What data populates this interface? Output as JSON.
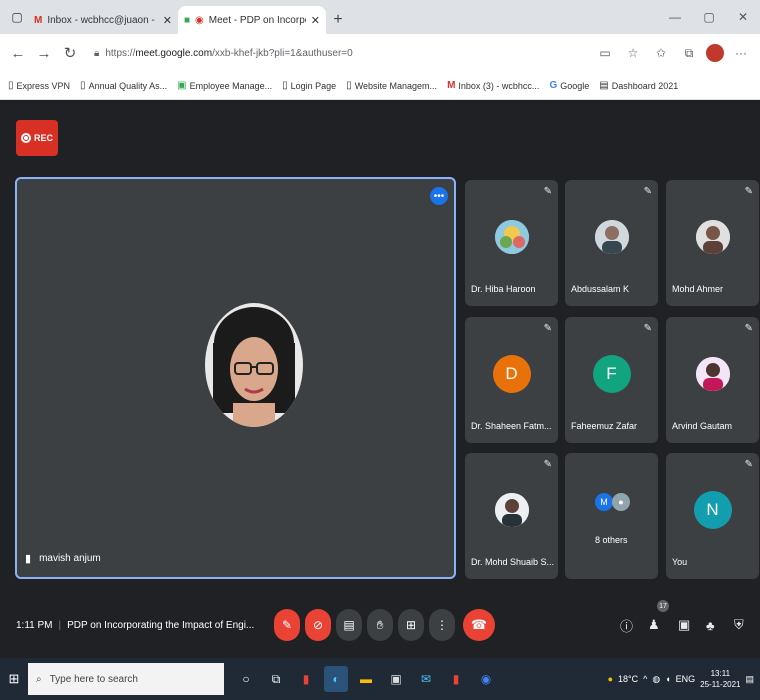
{
  "browser": {
    "tabs": [
      {
        "title": "Inbox - wcbhcc@juaon - E.M",
        "active": false
      },
      {
        "title": "Meet - PDP on Incorporati",
        "active": true
      }
    ],
    "url_prefix": "https://",
    "url_host": "meet.google.com",
    "url_path": "/xxb-khef-jkb?pli=1&authuser=0",
    "bookmarks": [
      "Express VPN",
      "Annual Quality As...",
      "Employee Manage...",
      "Login Page",
      "Website Managem...",
      "Inbox (3) - wcbhcc...",
      "Google",
      "Dashboard 2021"
    ]
  },
  "meet": {
    "rec_label": "REC",
    "main_speaker": "mavish anjum",
    "participants": [
      {
        "name": "Dr. Hiba Haroon",
        "avatar": "photo",
        "color": "#6aa84f"
      },
      {
        "name": "Abdussalam K",
        "avatar": "photo",
        "color": "#8d6e63"
      },
      {
        "name": "Mohd Ahmer",
        "avatar": "photo",
        "color": "#795548"
      },
      {
        "name": "Dr. Shaheen Fatm...",
        "avatar": "D",
        "color": "#e8710a"
      },
      {
        "name": "Faheemuz Zafar",
        "avatar": "F",
        "color": "#12a37f"
      },
      {
        "name": "Arvind Gautam",
        "avatar": "photo",
        "color": "#c2185b"
      },
      {
        "name": "Dr. Mohd Shuaib S...",
        "avatar": "photo",
        "color": "#5d4037"
      },
      {
        "name": "8 others",
        "avatar": "M",
        "color": "#1a73e8"
      },
      {
        "name": "You",
        "avatar": "N",
        "color": "#129eaf"
      }
    ],
    "time": "1:11 PM",
    "meeting_title": "PDP on Incorporating the Impact of Engi...",
    "people_count": "17"
  },
  "taskbar": {
    "search_placeholder": "Type here to search",
    "weather": "18°C",
    "lang": "ENG",
    "time": "13:11",
    "date": "25-11-2021"
  }
}
